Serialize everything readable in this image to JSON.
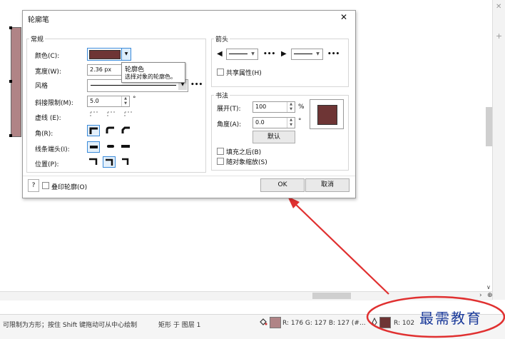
{
  "dialog": {
    "title": "轮廓笔",
    "close": "✕",
    "general_group": "常规",
    "color_label": "颜色(C):",
    "color_value": "#6e3535",
    "width_label": "宽度(W):",
    "width_value": "2.36 px",
    "style_label": "风格",
    "miter_label": "斜接限制(M):",
    "miter_value": "5.0",
    "miter_unit": "°",
    "dashes_label": "虚线 (E):",
    "corners_label": "角(R):",
    "caps_label": "线条端头(I):",
    "position_label": "位置(P):",
    "more": "•••",
    "arrows_group": "箭头",
    "share_attr": "共享属性(H)",
    "calligraphy_group": "书法",
    "stretch_label": "展开(T):",
    "stretch_value": "100",
    "stretch_unit": "%",
    "angle_label": "角度(A):",
    "angle_value": "0.0",
    "angle_unit": "°",
    "default_btn": "默认",
    "fill_behind": "填充之后(B)",
    "scale_with_object": "随对象缩放(S)",
    "help_btn": "?",
    "overprint": "叠印轮廓(O)",
    "ok_btn": "OK",
    "cancel_btn": "取消"
  },
  "tooltip": {
    "title": "轮廓色",
    "text": "选择对象的轮廓色。"
  },
  "status": {
    "hint": "可限制为方形；按住 Shift 键拖动可从中心绘制",
    "object": "矩形 于 图层 1",
    "fill_color": "#b08486",
    "fill_rgb": "R: 176 G: 127 B: 127 (#...",
    "outline_color": "#6e3535",
    "outline_rgb": "R: 102"
  },
  "watermark": "最需教育",
  "colors": {
    "annotation": "#e03030",
    "shape_fill": "#b08486",
    "outline": "#6e3535"
  }
}
